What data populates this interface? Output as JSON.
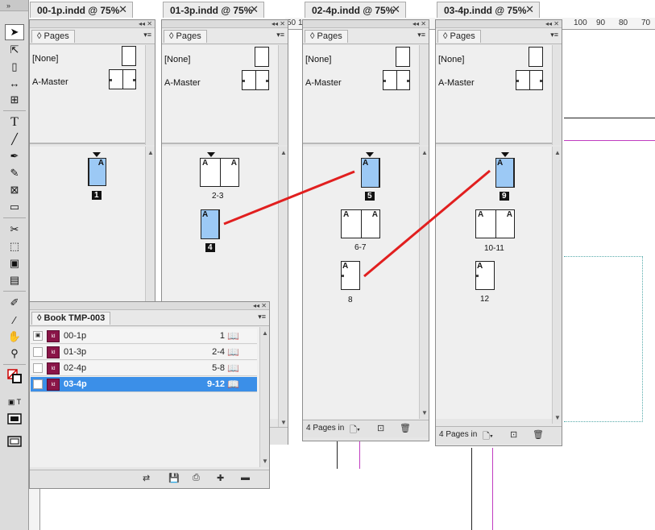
{
  "tabs": [
    {
      "name": "00-1p.indd @ 75%",
      "close": "✕"
    },
    {
      "name": "01-3p.indd @ 75%",
      "close": "✕"
    },
    {
      "name": "02-4p.indd @ 75%",
      "close": "✕"
    },
    {
      "name": "03-4p.indd @ 75%",
      "close": "✕"
    }
  ],
  "ruler": {
    "left_ticks": [
      "50",
      "1"
    ],
    "right_ticks": [
      "100",
      "90",
      "80",
      "70"
    ]
  },
  "panel": {
    "title": "Pages",
    "none_master": "[None]",
    "a_master": "A-Master",
    "menu_glyph": "▾≡",
    "collapse_glyph": "◂◂ ✕",
    "tab_glyph": "◊"
  },
  "panels": [
    {
      "pages": [
        {
          "label": "1"
        }
      ]
    },
    {
      "pages": [
        {
          "label": "2-3"
        },
        {
          "label": "4"
        }
      ]
    },
    {
      "pages": [
        {
          "label": "5"
        },
        {
          "label": "6-7"
        },
        {
          "label": "8"
        }
      ],
      "footer": "4 Pages in"
    },
    {
      "pages": [
        {
          "label": "9"
        },
        {
          "label": "10-11"
        },
        {
          "label": "12"
        }
      ],
      "footer": "4 Pages in"
    }
  ],
  "master_letter": "A",
  "book": {
    "title": "Book TMP-003",
    "rows": [
      {
        "name": "00-1p",
        "range": "1",
        "selected": false
      },
      {
        "name": "01-3p",
        "range": "2-4",
        "selected": false
      },
      {
        "name": "02-4p",
        "range": "5-8",
        "selected": false
      },
      {
        "name": "03-4p",
        "range": "9-12",
        "selected": true
      }
    ]
  },
  "colors": {
    "selection": "#3b8fe8",
    "page_fill": "#9cc9f5",
    "annotation_line": "#e11f1f",
    "guide": "#c03cc0"
  },
  "icons": [
    "selection-tool-icon",
    "direct-selection-tool-icon",
    "page-tool-icon",
    "gap-tool-icon",
    "content-collector-icon",
    "type-tool-icon",
    "line-tool-icon",
    "pen-tool-icon",
    "pencil-tool-icon",
    "rectangle-frame-tool-icon",
    "rectangle-tool-icon",
    "scissors-tool-icon",
    "free-transform-tool-icon",
    "gradient-swatch-tool-icon",
    "gradient-feather-tool-icon",
    "note-tool-icon",
    "eyedropper-tool-icon",
    "hand-tool-icon",
    "zoom-tool-icon"
  ]
}
